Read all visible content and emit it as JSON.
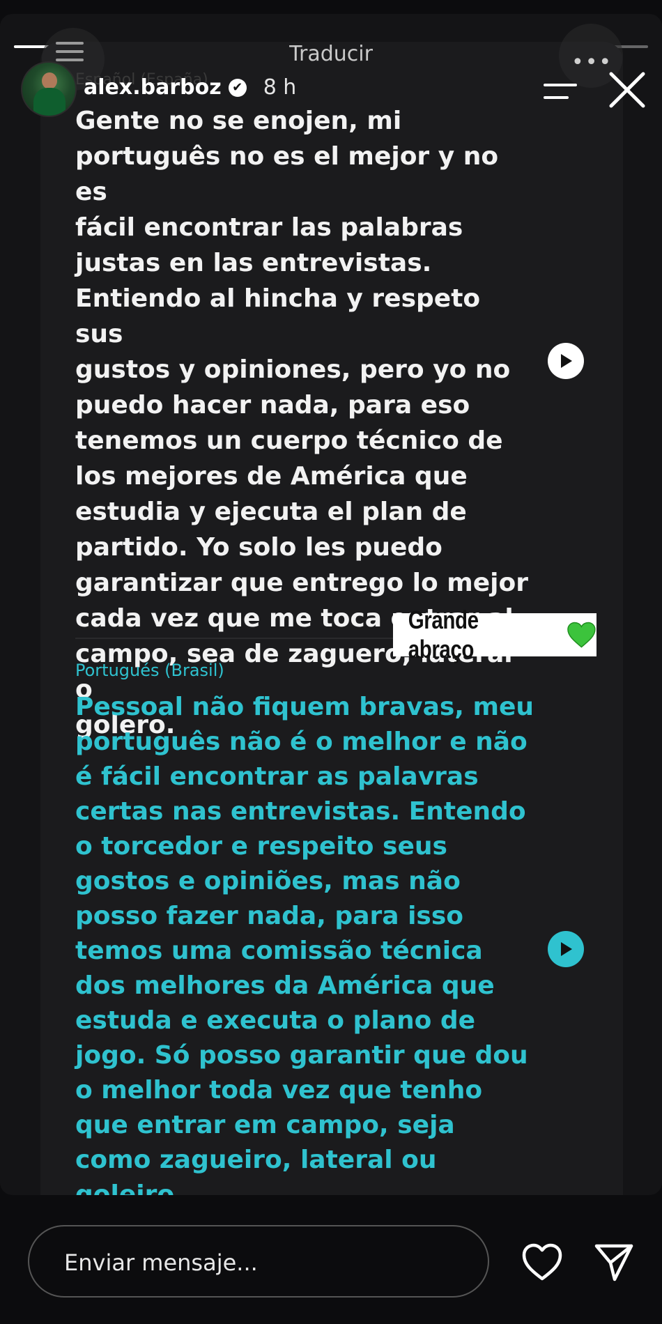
{
  "sheet": {
    "title": "Traducir"
  },
  "header": {
    "username": "alex.barboz",
    "verified_mark": "✔",
    "time": "8 h",
    "faded_language": "Español (España)"
  },
  "original": {
    "text": "Gente no se enojen, mi\nportuguês no es el mejor y no es\nfácil encontrar las palabras\njustas en las entrevistas.\nEntiendo al hincha y respeto sus\ngustos y opiniones, pero yo no\npuedo hacer nada, para eso\ntenemos un cuerpo técnico de\nlos mejores de América que\nestudia y ejecuta el plan de\npartido. Yo solo les puedo\ngarantizar que entrego lo mejor\ncada vez que me toca entrar al\ncampo, sea de zaguero, lateral o\ngolero."
  },
  "sticker": {
    "text": "Grande abraço",
    "emoji": "💚"
  },
  "translation": {
    "language_label": "Portugués (Brasil)",
    "text": "Pessoal não fiquem bravas, meu\nportuguês não é o melhor e não\né fácil encontrar as palavras\ncertas nas entrevistas. Entendo\no torcedor e respeito seus\ngostos e opiniões, mas não\nposso fazer nada, para isso\ntemos uma comissão técnica\ndos melhores da América que\nestuda e executa o plano de\njogo. Só posso garantir que dou\no melhor toda vez que tenho\nque entrar em campo, seja\ncomo zagueiro, lateral ou\ngoleiro."
  },
  "composer": {
    "placeholder": "Enviar mensaje..."
  },
  "story_progress": 0.54,
  "colors": {
    "accent_teal": "#2fc2cf",
    "background": "#141416"
  },
  "icons": [
    "list-icon",
    "more-dots-icon",
    "menu-icon",
    "close-icon",
    "play-icon",
    "heart-icon",
    "send-icon",
    "verified-icon"
  ]
}
